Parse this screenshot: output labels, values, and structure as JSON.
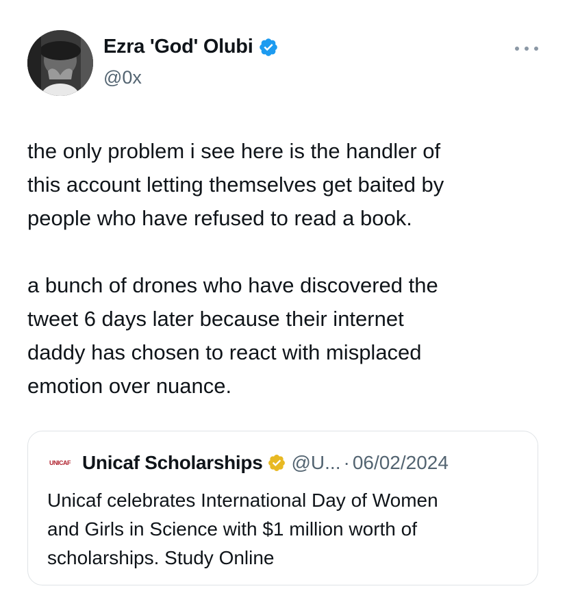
{
  "author": {
    "display_name": "Ezra 'God' Olubi",
    "handle": "@0x",
    "verified_color": "#1d9bf0",
    "avatar_icon": "profile-photo"
  },
  "menu": {
    "icon": "more-options-icon"
  },
  "tweet": {
    "paragraphs": [
      "the only problem i see here is the handler of\nthis account letting themselves get baited by\npeople who have refused to read a book.",
      "a bunch of drones who have discovered the\ntweet 6 days later because their internet\ndaddy has chosen to react with misplaced\nemotion over nuance."
    ]
  },
  "quoted": {
    "logo_text": "UNICAF",
    "display_name": "Unicaf Scholarships",
    "badge_color": "#e8b923",
    "handle": "@U...",
    "separator": "·",
    "date": "06/02/2024",
    "text": "Unicaf celebrates International Day of Women\nand Girls in Science with $1 million worth of\nscholarships. Study Online"
  }
}
